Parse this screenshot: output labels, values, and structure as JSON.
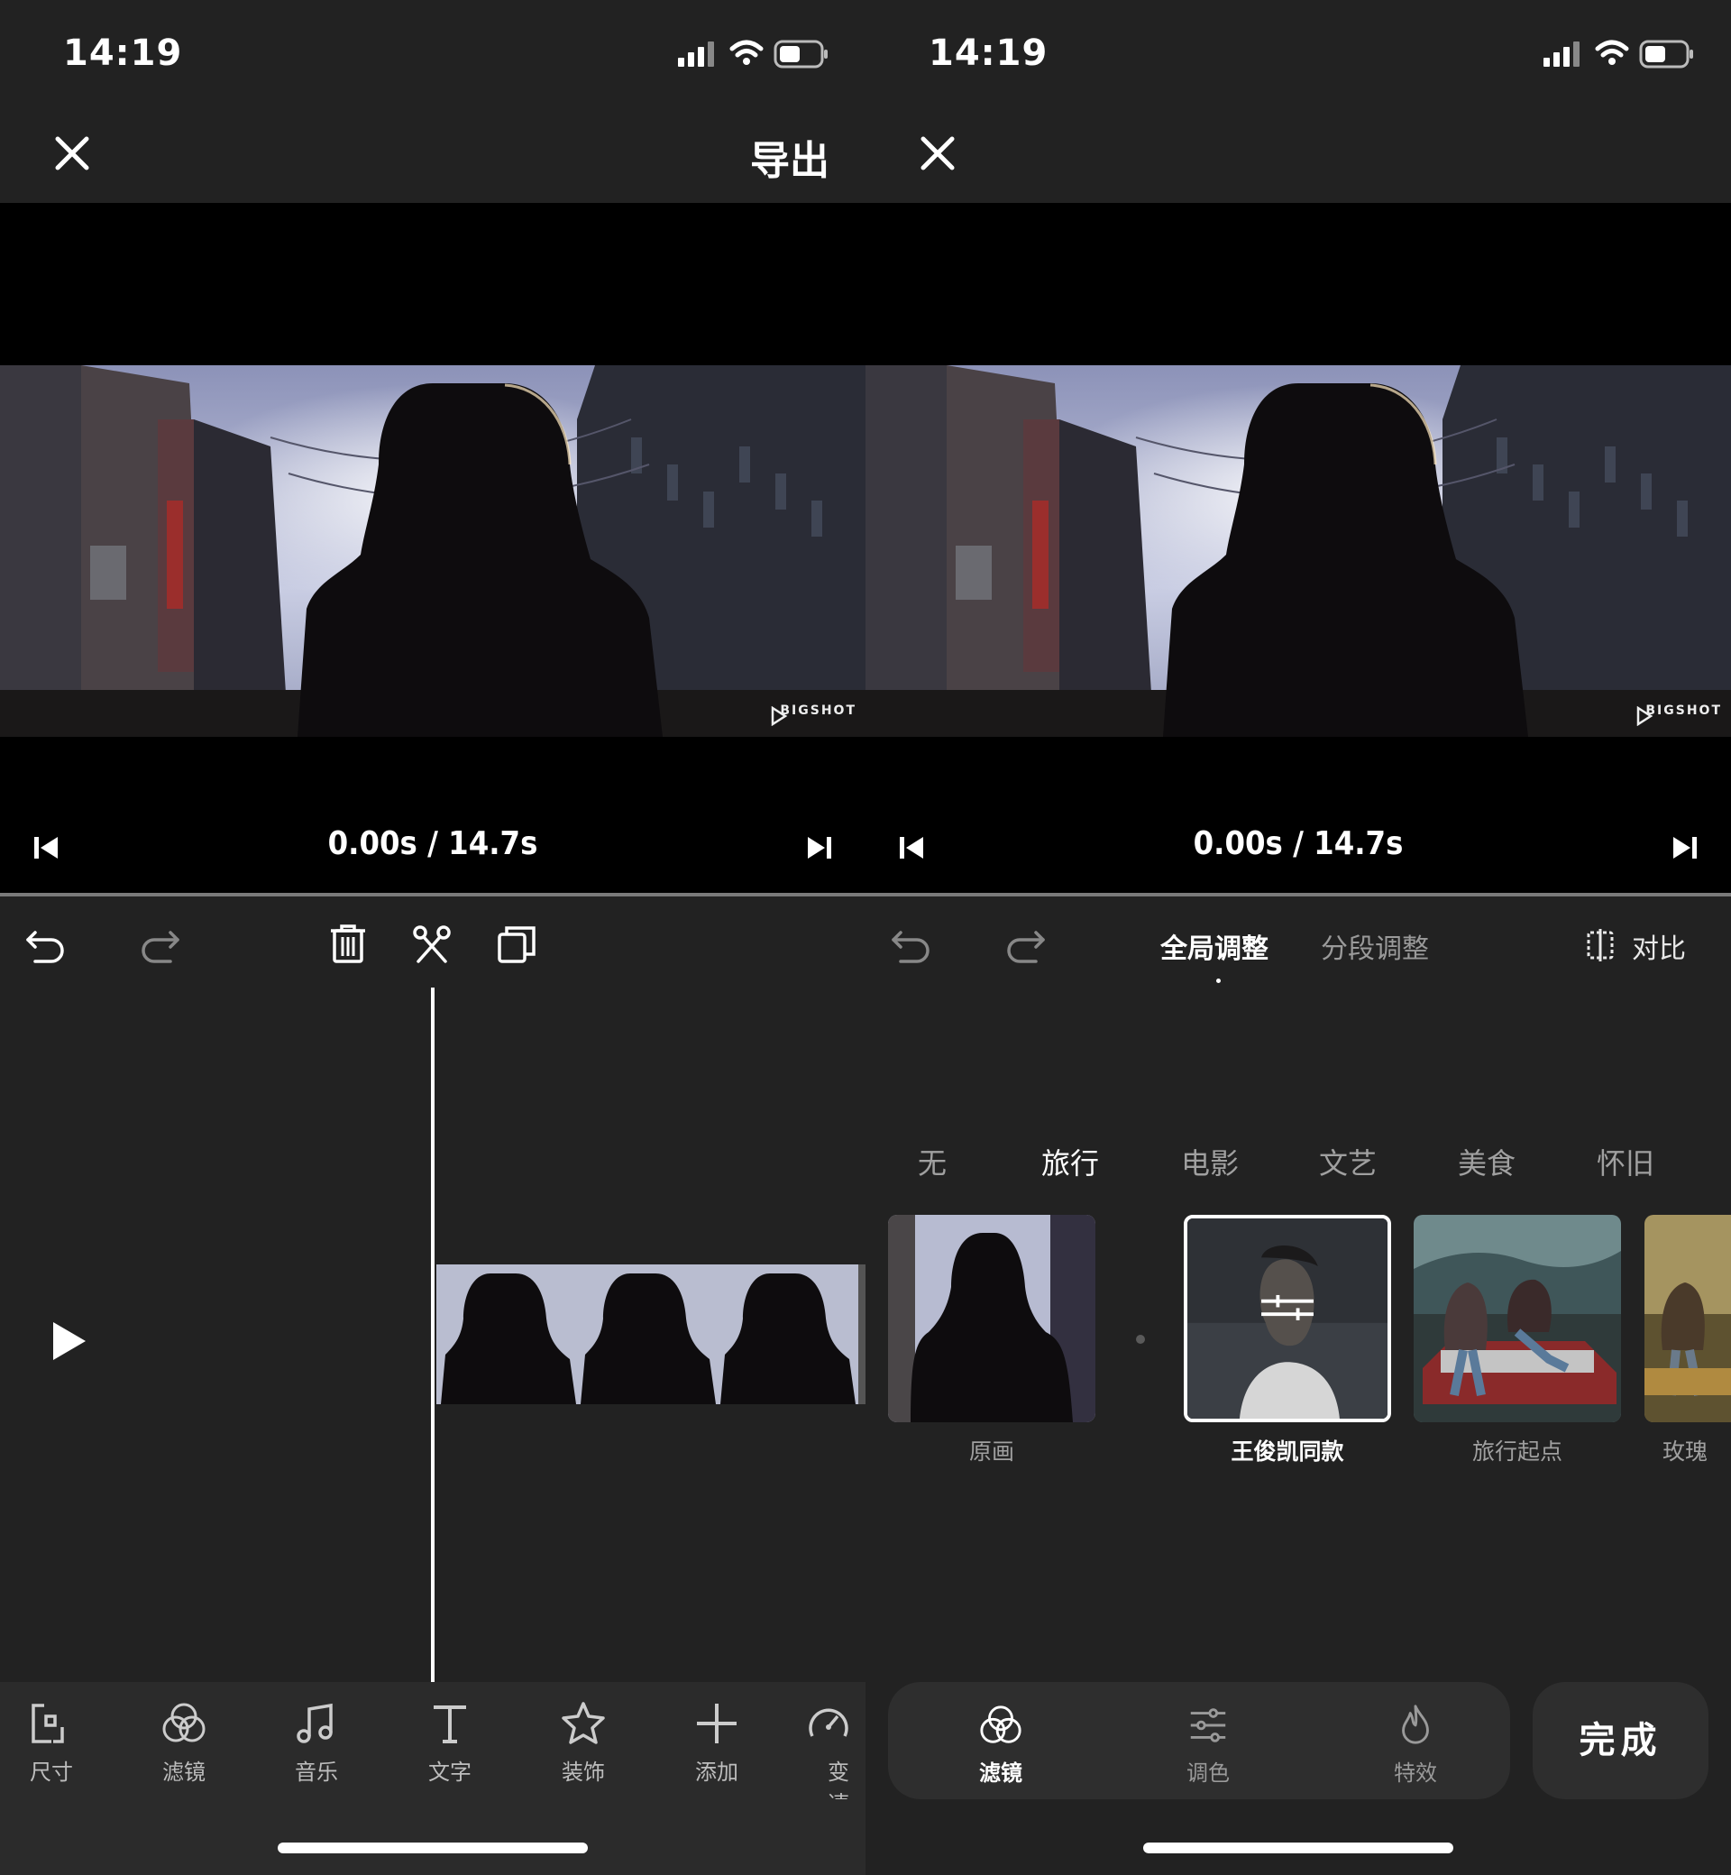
{
  "left": {
    "status": {
      "time": "14:19"
    },
    "header": {
      "export_label": "导出"
    },
    "player": {
      "time_readout": "0.00s / 14.7s",
      "watermark": "BIGSHOT"
    },
    "bottom_nav": [
      {
        "label": "尺寸",
        "icon": "crop-size-icon"
      },
      {
        "label": "滤镜",
        "icon": "filter-circles-icon"
      },
      {
        "label": "音乐",
        "icon": "music-note-icon"
      },
      {
        "label": "文字",
        "icon": "text-t-icon"
      },
      {
        "label": "装饰",
        "icon": "star-decoration-icon"
      },
      {
        "label": "添加",
        "icon": "plus-add-icon"
      },
      {
        "label": "变速",
        "icon": "speed-gauge-icon"
      }
    ]
  },
  "right": {
    "status": {
      "time": "14:19"
    },
    "player": {
      "time_readout": "0.00s / 14.7s",
      "watermark": "BIGSHOT"
    },
    "tabs": {
      "global": "全局调整",
      "segment": "分段调整"
    },
    "compare_label": "对比",
    "categories": [
      "无",
      "旅行",
      "电影",
      "文艺",
      "美食",
      "怀旧"
    ],
    "filters": [
      {
        "label": "原画"
      },
      {
        "label": "王俊凯同款"
      },
      {
        "label": "旅行起点"
      },
      {
        "label": "玫瑰"
      }
    ],
    "bottom_tabs": [
      "滤镜",
      "调色",
      "特效"
    ],
    "done_label": "完成"
  },
  "colors": {
    "background": "#222222",
    "video_bg": "#000000",
    "accent": "#ffffff",
    "muted": "#9a9a9a"
  }
}
